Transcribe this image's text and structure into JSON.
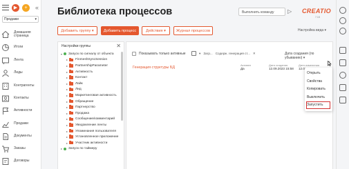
{
  "app": {
    "workspace": "Продажи",
    "logo_text": "CREATIO",
    "logo_sub": "7.18"
  },
  "header": {
    "title": "Библиотека процессов",
    "command_placeholder": "Выполнить команду",
    "command_go_icon": "arrow-right-icon"
  },
  "nav": {
    "items": [
      {
        "label": "Домашняя страница",
        "icon": "home-icon"
      },
      {
        "label": "Итоги",
        "icon": "pie-chart-icon"
      },
      {
        "label": "Лента",
        "icon": "feed-icon"
      },
      {
        "label": "Лиды",
        "icon": "lead-icon"
      },
      {
        "label": "Контрагенты",
        "icon": "building-icon"
      },
      {
        "label": "Контакты",
        "icon": "contact-icon"
      },
      {
        "label": "Активности",
        "icon": "flag-icon"
      },
      {
        "label": "Продажи",
        "icon": "sales-icon"
      },
      {
        "label": "Документы",
        "icon": "document-icon"
      },
      {
        "label": "Заказы",
        "icon": "cart-icon"
      },
      {
        "label": "Договоры",
        "icon": "contract-icon"
      }
    ]
  },
  "toolbar": {
    "add_group": "Добавить группу",
    "add_process": "Добавить процесс",
    "actions": "Действия",
    "process_log": "Журнал процессов",
    "view_settings": "Настройка вида"
  },
  "groups": {
    "title": "Настройки группы",
    "root": "Запуск по сигналу от объекта",
    "items": [
      "FinmeshSyncSession",
      "PartnershipParameter",
      "Активность",
      "Контакт",
      "Лайк",
      "Лид",
      "Маркетинговая активность",
      "Обращение",
      "Партнерство",
      "Продажа",
      "Сообщение/комментарий",
      "Уведомление ленты",
      "Упоминания пользователя",
      "Установленное приложение",
      "Участник активности"
    ],
    "next_root": "Запуск по таймеру"
  },
  "filters": {
    "active_only": "Показывать только активные",
    "f1": "Загр...",
    "f2": "Содерж. генерация ст...",
    "sort": "Дата создания (по убыванию)"
  },
  "record": {
    "name": "Генерация структуры БД",
    "active_label": "Активен",
    "active_value": "Да",
    "created_label": "Дата создания",
    "created_value": "12.09.2023 15:58",
    "modified_label": "Дата изменения",
    "modified_value": "12.09.2023 1..."
  },
  "context_menu": {
    "items": [
      "Открыть",
      "Свойства",
      "Копировать",
      "Выключить",
      "Запустить"
    ],
    "highlighted": "Запустить"
  },
  "colors": {
    "accent": "#e4572e",
    "highlight": "#d32f2f"
  }
}
